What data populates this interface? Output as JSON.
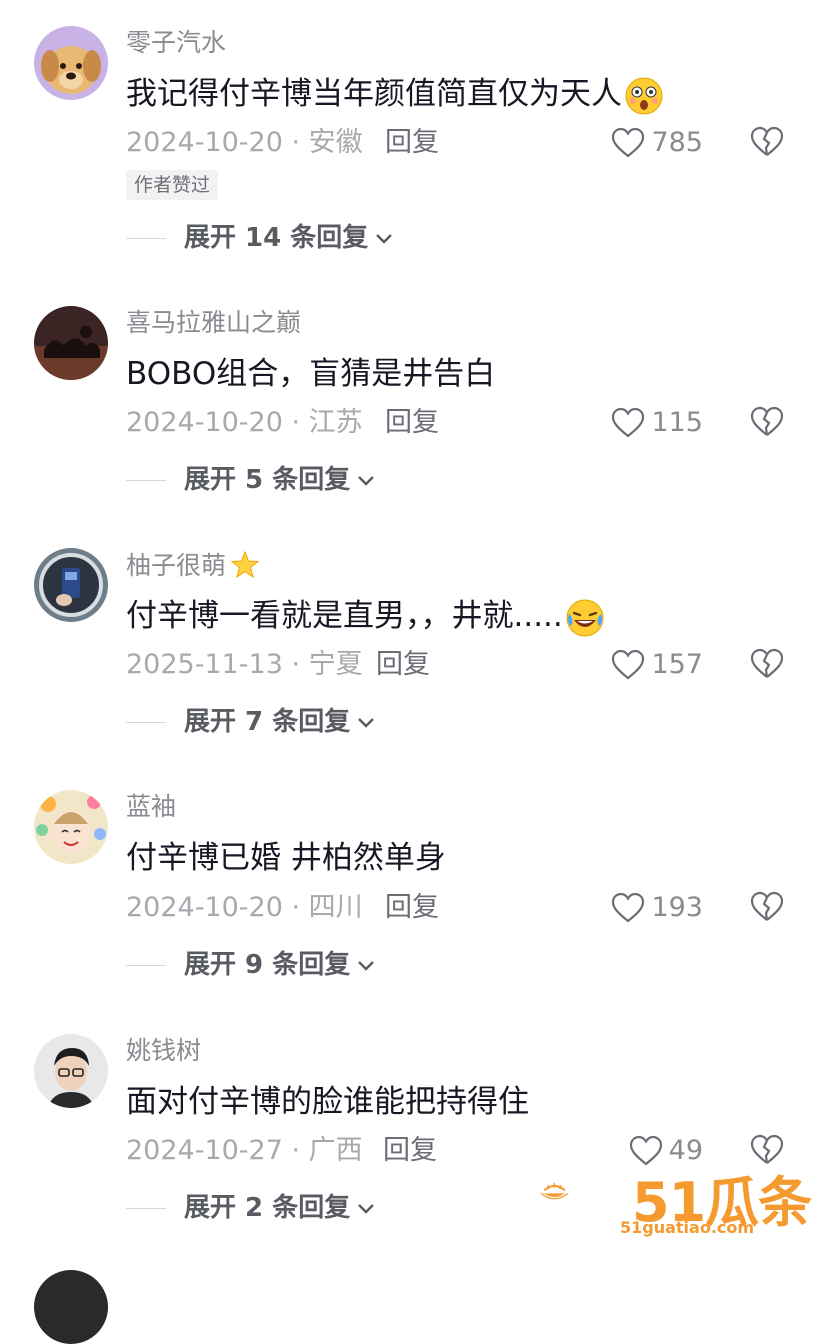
{
  "comments": [
    {
      "username": "零子汽水",
      "text": "我记得付辛博当年颜值简直仅为天人",
      "meta": "2024-10-20 · 安徽",
      "reply": "回复",
      "likes": "785",
      "author_liked": "作者赞过",
      "expand": "展开 14 条回复"
    },
    {
      "username": "喜马拉雅山之巅",
      "text": "BOBO组合，盲猜是井告白",
      "meta": "2024-10-20 · 江苏",
      "reply": "回复",
      "likes": "115",
      "expand": "展开 5 条回复"
    },
    {
      "username": "柚子很萌",
      "text": "付辛博一看就是直男，，井就.....",
      "meta": "2025-11-13 · 宁夏",
      "reply": "回复",
      "likes": "157",
      "expand": "展开 7 条回复"
    },
    {
      "username": "蓝袖",
      "text": "付辛博已婚  井柏然单身",
      "meta": "2024-10-20 · 四川",
      "reply": "回复",
      "likes": "193",
      "expand": "展开 9 条回复"
    },
    {
      "username": "姚钱树",
      "text": "面对付辛博的脸谁能把持得住",
      "meta": "2024-10-27 · 广西",
      "reply": "回复",
      "likes": "49",
      "expand": "展开 2 条回复"
    }
  ],
  "watermark": {
    "brand": "51瓜条",
    "url": "51guatiao.com"
  },
  "colors": {
    "text": "#161823",
    "muted": "#8a8b91",
    "watermark": "#f59a2e"
  }
}
